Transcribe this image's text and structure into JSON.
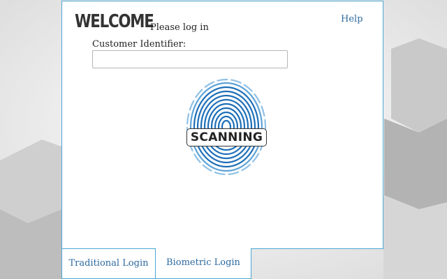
{
  "header": {
    "title": "WELCOME",
    "subtitle": "Please log in",
    "help_link": "Help"
  },
  "form": {
    "customer_id_label": "Customer Identifier:",
    "customer_id_value": "",
    "customer_id_placeholder": ""
  },
  "scanner": {
    "status": "SCANNING",
    "icon": "fingerprint-icon"
  },
  "tabs": [
    {
      "label": "Traditional Login",
      "active": false
    },
    {
      "label": "Biometric Login",
      "active": true
    }
  ],
  "colors": {
    "accent_border": "#4aa8d4",
    "link": "#2d6a9f",
    "fingerprint": "#1e6fb8"
  }
}
